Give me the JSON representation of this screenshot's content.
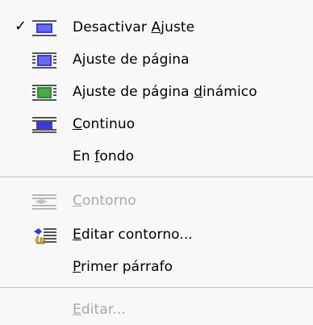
{
  "menu": {
    "items": [
      {
        "label": "Desactivar Ajuste",
        "checked": true,
        "enabled": true,
        "icon": "text-wrap-disable-icon"
      },
      {
        "label": "Ajuste de página",
        "checked": false,
        "enabled": true,
        "icon": "wrap-page-icon"
      },
      {
        "label": "Ajuste de página dinámico",
        "checked": false,
        "enabled": true,
        "icon": "wrap-page-dynamic-icon"
      },
      {
        "label": "Continuo",
        "checked": false,
        "enabled": true,
        "icon": "wrap-continuous-icon"
      },
      {
        "label": "En fondo",
        "checked": false,
        "enabled": true,
        "icon": ""
      },
      {
        "label": "Contorno",
        "checked": false,
        "enabled": false,
        "icon": "contour-icon"
      },
      {
        "label": "Editar contorno...",
        "checked": false,
        "enabled": true,
        "icon": "edit-contour-icon"
      },
      {
        "label": "Primer párrafo",
        "checked": false,
        "enabled": true,
        "icon": ""
      },
      {
        "label": "Editar...",
        "checked": false,
        "enabled": false,
        "icon": ""
      }
    ]
  },
  "colors": {
    "background": "#f8f8f8",
    "disabled_text": "#a8a8a8",
    "icon_blue": "#3a3ad8",
    "icon_green": "#2e8b2e"
  }
}
